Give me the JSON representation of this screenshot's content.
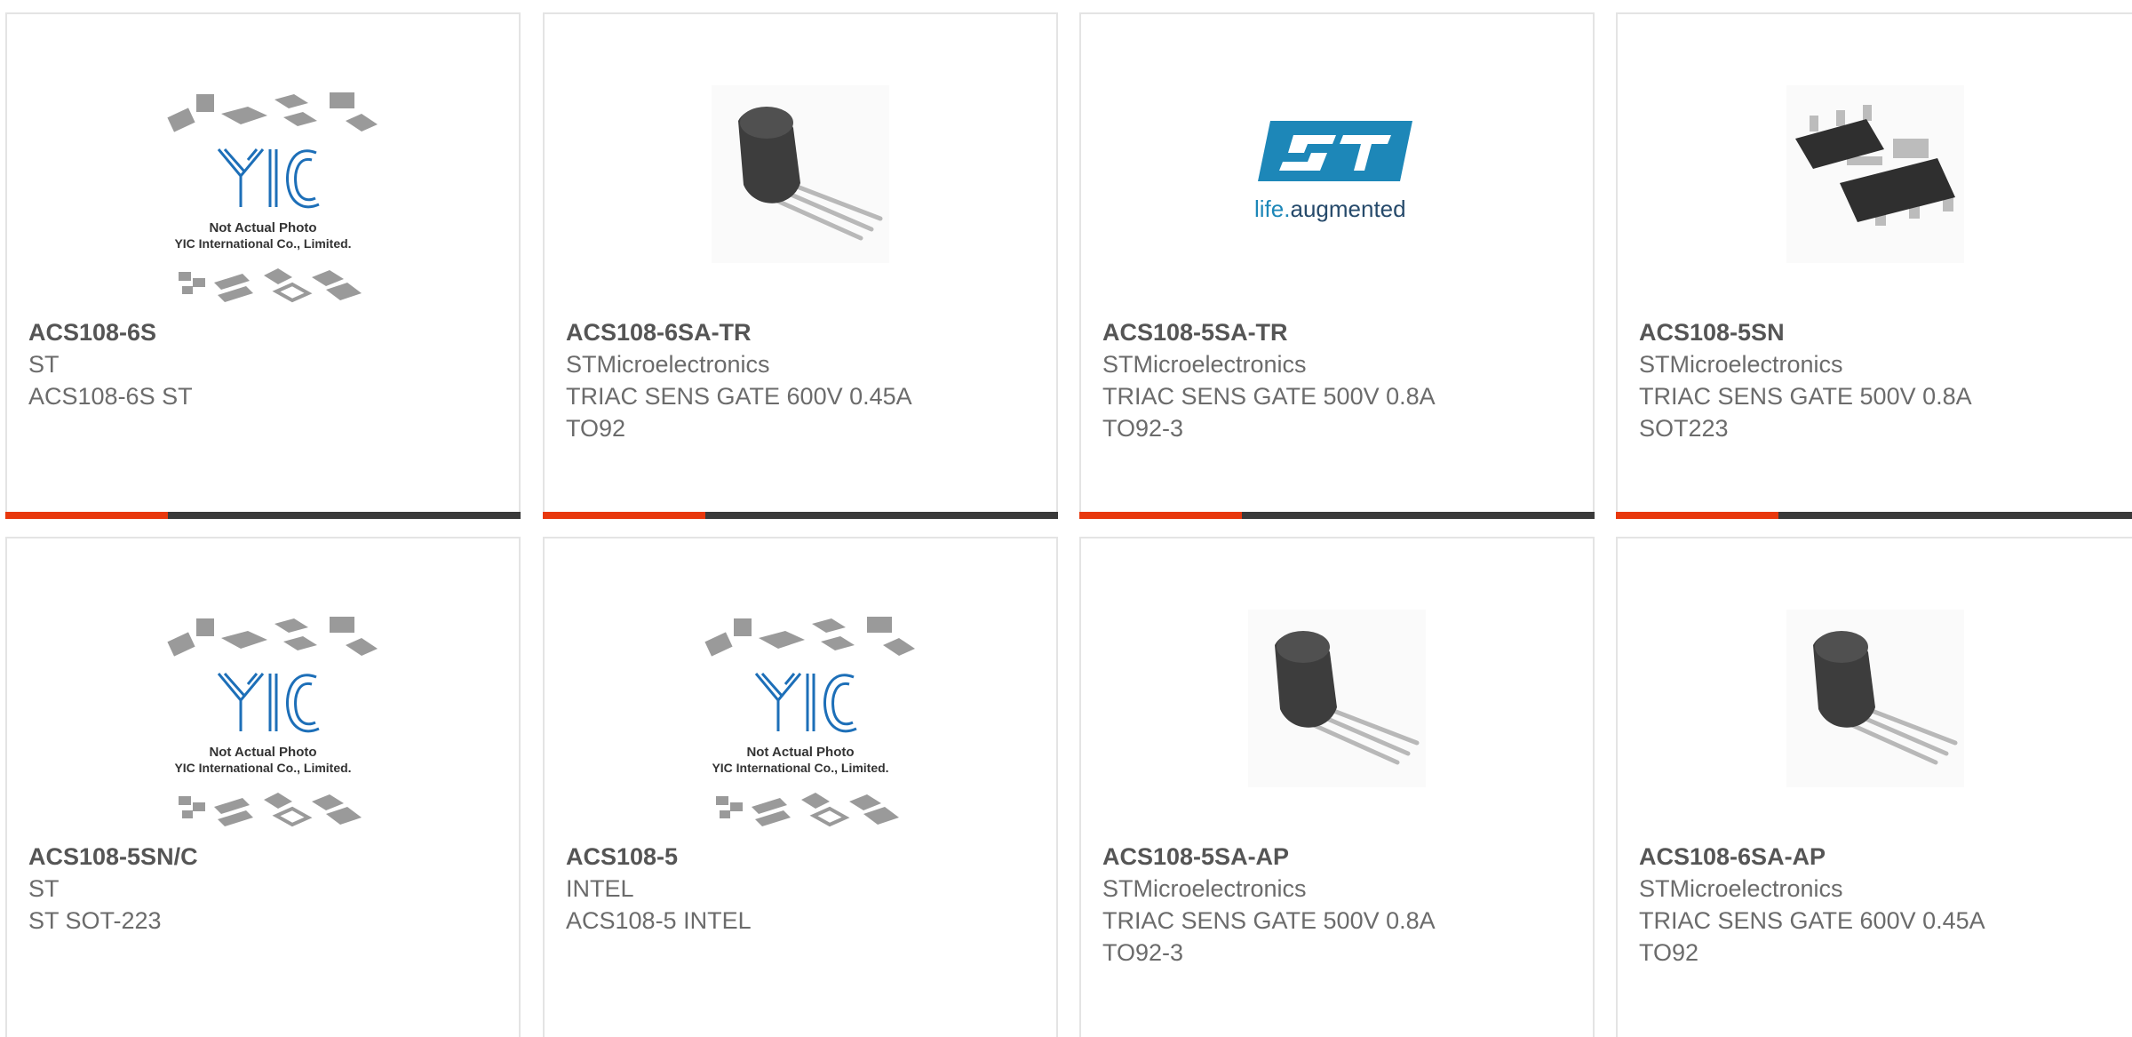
{
  "colors": {
    "accent": "#e8380d",
    "bar": "#3a3a3a",
    "border": "#e4e4e4",
    "st_blue": "#1d87b8"
  },
  "products": [
    {
      "part": "ACS108-6S",
      "maker": "ST",
      "desc1": "ACS108-6S ST",
      "desc2": "",
      "image": "yic-placeholder-icon"
    },
    {
      "part": "ACS108-6SA-TR",
      "maker": "STMicroelectronics",
      "desc1": "TRIAC SENS GATE 600V 0.45A",
      "desc2": "TO92",
      "image": "to92-transistor-icon"
    },
    {
      "part": "ACS108-5SA-TR",
      "maker": "STMicroelectronics",
      "desc1": "TRIAC SENS GATE 500V 0.8A",
      "desc2": "TO92-3",
      "image": "st-logo-icon"
    },
    {
      "part": "ACS108-5SN",
      "maker": "STMicroelectronics",
      "desc1": "TRIAC SENS GATE 500V 0.8A",
      "desc2": "SOT223",
      "image": "sot223-package-icon"
    },
    {
      "part": "ACS108-5SN/C",
      "maker": "ST",
      "desc1": "ST SOT-223",
      "desc2": "",
      "image": "yic-placeholder-icon"
    },
    {
      "part": "ACS108-5",
      "maker": "INTEL",
      "desc1": "ACS108-5 INTEL",
      "desc2": "",
      "image": "yic-placeholder-icon"
    },
    {
      "part": "ACS108-5SA-AP",
      "maker": "STMicroelectronics",
      "desc1": "TRIAC SENS GATE 500V 0.8A",
      "desc2": "TO92-3",
      "image": "to92-transistor-icon"
    },
    {
      "part": "ACS108-6SA-AP",
      "maker": "STMicroelectronics",
      "desc1": "TRIAC SENS GATE 600V 0.45A",
      "desc2": "TO92",
      "image": "to92-transistor-icon"
    }
  ],
  "yic": {
    "logo": "YIC",
    "line1": "Not Actual Photo",
    "line2": "YIC International Co., Limited."
  },
  "st_logo": {
    "mark": "ST",
    "life": "life",
    "dot": ".",
    "augmented": "augmented"
  }
}
